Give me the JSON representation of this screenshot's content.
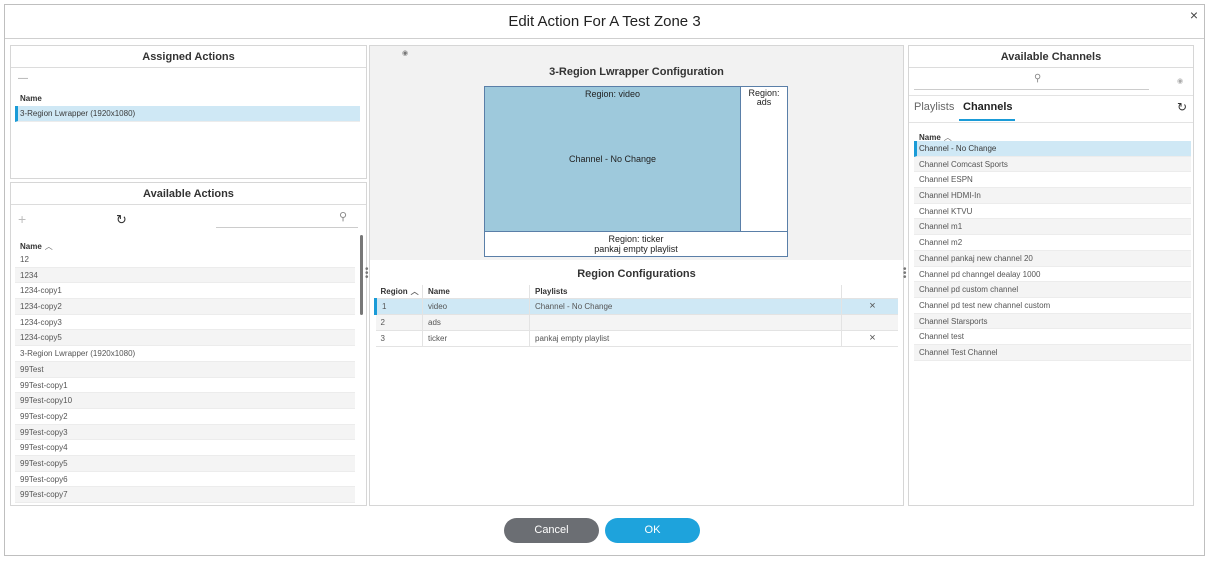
{
  "dialog": {
    "title": "Edit Action For A Test Zone 3",
    "close": "×"
  },
  "assigned": {
    "title": "Assigned Actions",
    "remove_glyph": "—",
    "column": "Name",
    "rows": [
      "3-Region Lwrapper (1920x1080)"
    ]
  },
  "available_actions": {
    "title": "Available Actions",
    "add_glyph": "+",
    "refresh_glyph": "↻",
    "search_glyph": "⚲",
    "column": "Name",
    "sort_glyph": "︿",
    "rows": [
      "12",
      "1234",
      "1234-copy1",
      "1234-copy2",
      "1234-copy3",
      "1234-copy5",
      "3-Region Lwrapper (1920x1080)",
      "99Test",
      "99Test-copy1",
      "99Test-copy10",
      "99Test-copy2",
      "99Test-copy3",
      "99Test-copy4",
      "99Test-copy5",
      "99Test-copy6",
      "99Test-copy7"
    ]
  },
  "config": {
    "eye_glyph": "◉",
    "title": "3-Region Lwrapper Configuration",
    "video_region": "Region: video",
    "video_content": "Channel - No Change",
    "ads_region": "Region: ads",
    "ticker_region": "Region: ticker",
    "ticker_content": "pankaj empty playlist",
    "colors": {
      "video_fill": "#9ec9dc",
      "border": "#5a7fa8"
    }
  },
  "region_configs": {
    "title": "Region Configurations",
    "columns": {
      "region": "Region",
      "name": "Name",
      "playlists": "Playlists"
    },
    "sort_glyph": "︿",
    "remove_glyph": "×",
    "rows": [
      {
        "region": "1",
        "name": "video",
        "playlist": "Channel - No Change",
        "remove": "×"
      },
      {
        "region": "2",
        "name": "ads",
        "playlist": "",
        "remove": ""
      },
      {
        "region": "3",
        "name": "ticker",
        "playlist": "pankaj empty playlist",
        "remove": "×"
      }
    ]
  },
  "channels": {
    "title": "Available Channels",
    "search_glyph": "⚲",
    "eye_glyph": "◉",
    "tabs": [
      "Playlists",
      "Channels"
    ],
    "active_tab": "Channels",
    "refresh_glyph": "↻",
    "column": "Name",
    "sort_glyph": "︿",
    "rows": [
      "Channel - No Change",
      "Channel Comcast Sports",
      "Channel ESPN",
      "Channel HDMI-In",
      "Channel KTVU",
      "Channel m1",
      "Channel m2",
      "Channel pankaj new channel 20",
      "Channel pd channgel dealay 1000",
      "Channel pd custom channel",
      "Channel pd test new channel custom",
      "Channel Starsports",
      "Channel test",
      "Channel Test Channel"
    ]
  },
  "footer": {
    "cancel": "Cancel",
    "ok": "OK",
    "colors": {
      "cancel": "#6b6e73",
      "ok": "#1ea3dc"
    }
  }
}
